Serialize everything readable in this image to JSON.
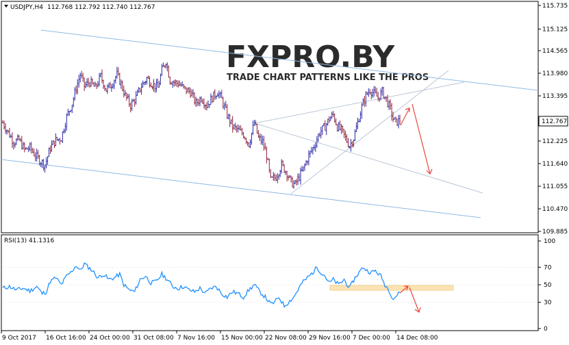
{
  "main_header": {
    "symbol": "USDJPY,H4",
    "ohlc": "112.768 112.792 112.740 112.767"
  },
  "rsi_header": "RSI(13) 41.1316",
  "logo": {
    "main": "FXPRO.BY",
    "tagline": "TRADE CHART PATTERNS LIKE THE PROS"
  },
  "colors": {
    "bull": "#2626a6",
    "bear": "#8a1f3a",
    "channel": "#8fb9e6",
    "wedge": "#b8c6d6",
    "rsi": "#1e90ff",
    "arrow": "#e8453c",
    "zone": "#fbe3b4"
  },
  "chart_data": [
    {
      "type": "candlestick",
      "symbol": "USDJPY",
      "timeframe": "H4",
      "last_price": "112.767",
      "ylim": [
        109.885,
        115.735
      ],
      "y_ticks": [
        "115.735",
        "115.125",
        "114.565",
        "113.980",
        "113.395",
        "112.767",
        "112.225",
        "111.640",
        "111.055",
        "110.470",
        "109.885"
      ],
      "x_ticks": [
        "9 Oct 2017",
        "16 Oct 16:00",
        "24 Oct 00:00",
        "31 Oct 08:00",
        "7 Nov 16:00",
        "15 Nov 00:00",
        "22 Nov 08:00",
        "29 Nov 16:00",
        "7 Dec 00:00",
        "14 Dec 08:00"
      ],
      "close_path": [
        [
          0,
          112.7
        ],
        [
          8,
          112.45
        ],
        [
          16,
          112.2
        ],
        [
          24,
          112.25
        ],
        [
          32,
          112.0
        ],
        [
          40,
          112.05
        ],
        [
          48,
          111.85
        ],
        [
          56,
          111.7
        ],
        [
          62,
          111.6
        ],
        [
          70,
          112.05
        ],
        [
          78,
          112.25
        ],
        [
          86,
          112.3
        ],
        [
          94,
          112.85
        ],
        [
          102,
          113.2
        ],
        [
          108,
          113.6
        ],
        [
          114,
          113.95
        ],
        [
          120,
          113.65
        ],
        [
          128,
          113.75
        ],
        [
          136,
          113.6
        ],
        [
          144,
          113.9
        ],
        [
          152,
          113.55
        ],
        [
          160,
          113.7
        ],
        [
          168,
          113.95
        ],
        [
          174,
          113.7
        ],
        [
          180,
          113.4
        ],
        [
          188,
          113.15
        ],
        [
          196,
          113.35
        ],
        [
          204,
          113.65
        ],
        [
          212,
          113.85
        ],
        [
          220,
          113.7
        ],
        [
          228,
          113.6
        ],
        [
          234,
          114.05
        ],
        [
          240,
          114.3
        ],
        [
          246,
          113.8
        ],
        [
          252,
          113.75
        ],
        [
          260,
          113.7
        ],
        [
          268,
          113.55
        ],
        [
          276,
          113.5
        ],
        [
          284,
          113.2
        ],
        [
          292,
          113.35
        ],
        [
          300,
          113.15
        ],
        [
          308,
          113.35
        ],
        [
          316,
          113.5
        ],
        [
          322,
          113.3
        ],
        [
          330,
          112.9
        ],
        [
          338,
          112.6
        ],
        [
          346,
          112.5
        ],
        [
          354,
          112.4
        ],
        [
          362,
          112.15
        ],
        [
          370,
          112.7
        ],
        [
          376,
          112.3
        ],
        [
          382,
          112.2
        ],
        [
          388,
          111.85
        ],
        [
          394,
          111.2
        ],
        [
          402,
          111.3
        ],
        [
          410,
          111.6
        ],
        [
          418,
          111.4
        ],
        [
          424,
          111.15
        ],
        [
          430,
          111.1
        ],
        [
          436,
          111.3
        ],
        [
          442,
          111.5
        ],
        [
          450,
          111.85
        ],
        [
          458,
          112.1
        ],
        [
          466,
          112.45
        ],
        [
          474,
          112.6
        ],
        [
          480,
          112.8
        ],
        [
          486,
          112.9
        ],
        [
          492,
          112.6
        ],
        [
          498,
          112.5
        ],
        [
          504,
          112.3
        ],
        [
          510,
          112.1
        ],
        [
          516,
          112.3
        ],
        [
          522,
          112.7
        ],
        [
          528,
          113.1
        ],
        [
          534,
          113.4
        ],
        [
          540,
          113.55
        ],
        [
          546,
          113.45
        ],
        [
          552,
          113.35
        ],
        [
          558,
          113.5
        ],
        [
          564,
          113.3
        ],
        [
          570,
          113.05
        ],
        [
          574,
          112.8
        ],
        [
          578,
          112.7
        ],
        [
          584,
          112.767
        ]
      ]
    },
    {
      "type": "line",
      "series": [
        {
          "name": "RSI(13)",
          "last": 41.1316
        }
      ],
      "ylim": [
        0,
        100
      ],
      "y_ticks": [
        "100",
        "70",
        "50",
        "30",
        "0"
      ],
      "rsi_path": [
        [
          0,
          46
        ],
        [
          10,
          48
        ],
        [
          20,
          44
        ],
        [
          30,
          46
        ],
        [
          40,
          43
        ],
        [
          50,
          48
        ],
        [
          58,
          40
        ],
        [
          64,
          42
        ],
        [
          70,
          54
        ],
        [
          78,
          58
        ],
        [
          86,
          50
        ],
        [
          94,
          60
        ],
        [
          100,
          64
        ],
        [
          108,
          72
        ],
        [
          114,
          66
        ],
        [
          120,
          74
        ],
        [
          126,
          70
        ],
        [
          132,
          66
        ],
        [
          140,
          58
        ],
        [
          148,
          62
        ],
        [
          156,
          56
        ],
        [
          164,
          58
        ],
        [
          172,
          62
        ],
        [
          178,
          50
        ],
        [
          186,
          44
        ],
        [
          194,
          42
        ],
        [
          202,
          56
        ],
        [
          210,
          60
        ],
        [
          218,
          52
        ],
        [
          226,
          54
        ],
        [
          234,
          62
        ],
        [
          242,
          56
        ],
        [
          250,
          48
        ],
        [
          258,
          46
        ],
        [
          266,
          48
        ],
        [
          274,
          44
        ],
        [
          282,
          42
        ],
        [
          290,
          46
        ],
        [
          298,
          40
        ],
        [
          306,
          46
        ],
        [
          314,
          48
        ],
        [
          322,
          40
        ],
        [
          330,
          36
        ],
        [
          338,
          42
        ],
        [
          346,
          40
        ],
        [
          354,
          36
        ],
        [
          362,
          44
        ],
        [
          370,
          50
        ],
        [
          378,
          42
        ],
        [
          386,
          36
        ],
        [
          394,
          28
        ],
        [
          400,
          30
        ],
        [
          406,
          36
        ],
        [
          414,
          26
        ],
        [
          420,
          30
        ],
        [
          428,
          36
        ],
        [
          434,
          44
        ],
        [
          440,
          52
        ],
        [
          448,
          58
        ],
        [
          456,
          64
        ],
        [
          462,
          70
        ],
        [
          468,
          64
        ],
        [
          474,
          60
        ],
        [
          480,
          52
        ],
        [
          486,
          56
        ],
        [
          494,
          50
        ],
        [
          502,
          56
        ],
        [
          510,
          46
        ],
        [
          518,
          58
        ],
        [
          524,
          64
        ],
        [
          530,
          70
        ],
        [
          536,
          66
        ],
        [
          542,
          64
        ],
        [
          548,
          66
        ],
        [
          556,
          60
        ],
        [
          562,
          50
        ],
        [
          568,
          44
        ],
        [
          574,
          34
        ],
        [
          580,
          38
        ],
        [
          584,
          41.1316
        ]
      ]
    }
  ]
}
